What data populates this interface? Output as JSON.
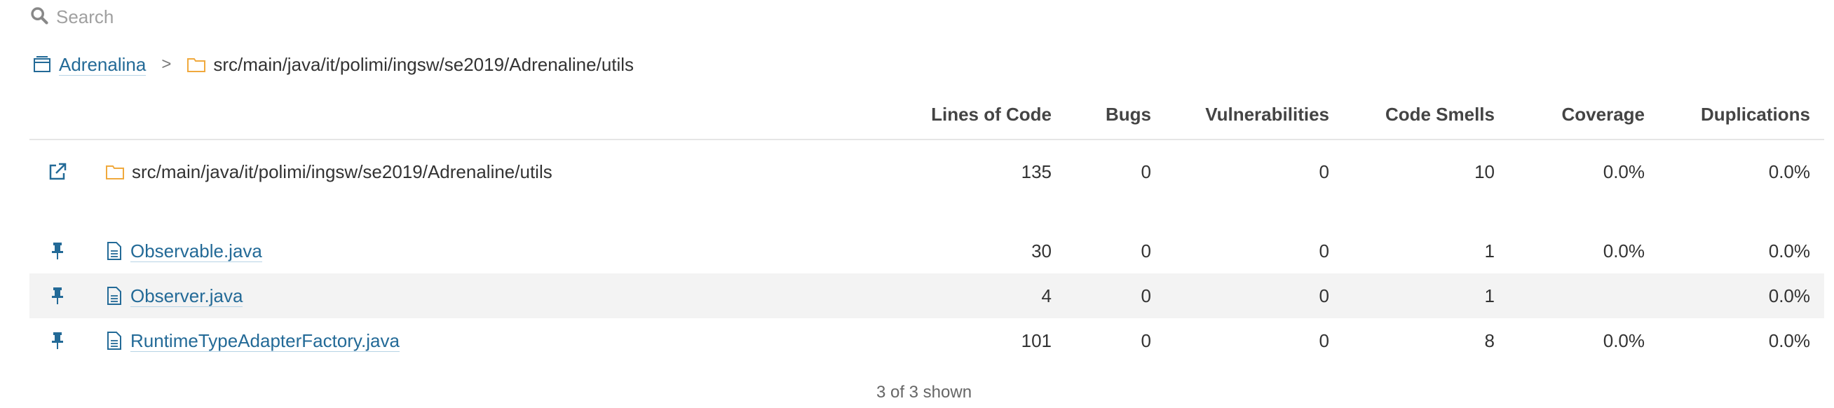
{
  "search": {
    "placeholder": "Search"
  },
  "breadcrumb": {
    "project": "Adrenalina",
    "separator": ">",
    "path": "src/main/java/it/polimi/ingsw/se2019/Adrenaline/utils"
  },
  "table": {
    "columns": {
      "loc": "Lines of Code",
      "bugs": "Bugs",
      "vulnerabilities": "Vulnerabilities",
      "code_smells": "Code Smells",
      "coverage": "Coverage",
      "duplications": "Duplications"
    },
    "directory": {
      "name": "src/main/java/it/polimi/ingsw/se2019/Adrenaline/utils",
      "loc": "135",
      "bugs": "0",
      "vulnerabilities": "0",
      "code_smells": "10",
      "coverage": "0.0%",
      "duplications": "0.0%"
    },
    "files": [
      {
        "name": "Observable.java",
        "loc": "30",
        "bugs": "0",
        "vulnerabilities": "0",
        "code_smells": "1",
        "coverage": "0.0%",
        "duplications": "0.0%"
      },
      {
        "name": "Observer.java",
        "loc": "4",
        "bugs": "0",
        "vulnerabilities": "0",
        "code_smells": "1",
        "coverage": "",
        "duplications": "0.0%"
      },
      {
        "name": "RuntimeTypeAdapterFactory.java",
        "loc": "101",
        "bugs": "0",
        "vulnerabilities": "0",
        "code_smells": "8",
        "coverage": "0.0%",
        "duplications": "0.0%"
      }
    ]
  },
  "footer": {
    "shown": "3 of 3 shown"
  },
  "colors": {
    "link": "#236a97",
    "folder": "#f0a93d",
    "row_alt": "#f3f3f3",
    "icon_blue": "#236a97"
  },
  "icons": {
    "search": "search-icon",
    "project": "project-icon",
    "folder": "folder-icon",
    "open_link": "external-link-icon",
    "pin": "pin-icon",
    "file": "file-icon"
  }
}
